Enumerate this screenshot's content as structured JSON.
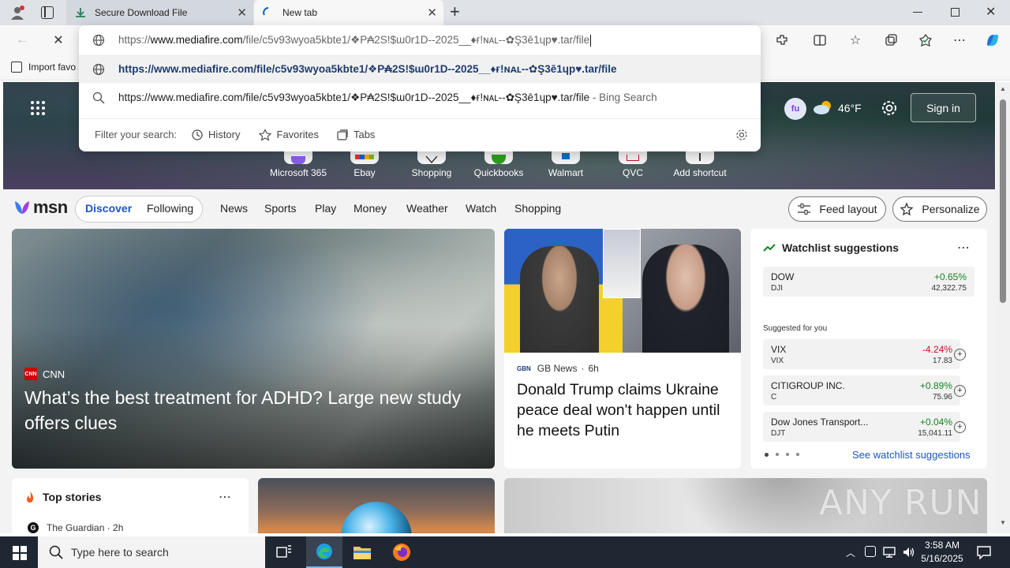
{
  "browser": {
    "tabs": [
      {
        "title": "Secure Download File",
        "active": false
      },
      {
        "title": "New tab",
        "active": true
      }
    ],
    "address_text": "https://www.mediafire.com/file/c5v93wyoa5kbte1/❖P₳2S!$ɯ0r1D--2025__♦ғ!ɴᴀʟ--✿Ş3ē1ɥp♥.tar/file",
    "address_host": "www.mediafire.com",
    "address_prefix": "https://",
    "address_path": "/file/c5v93wyoa5kbte1/❖P₳2S!$ɯ0r1D--2025__♦ғ!ɴᴀʟ--✿Ş3ē1ɥp♥.tar/file",
    "suggestion_url": "https://www.mediafire.com/file/c5v93wyoa5kbte1/❖P₳2S!$ɯ0r1D--2025__♦ғ!ɴᴀʟ--✿Ş3ē1ɥp♥.tar/file",
    "search_suggestion": "https://www.mediafire.com/file/c5v93wyoa5kbte1/❖P₳2S!$ɯ0r1D--2025__♦ғ!ɴᴀʟ--✿Ş3ē1ɥp♥.tar/file",
    "search_suffix": " - Bing Search",
    "filter_label": "Filter your search:",
    "filters": [
      "History",
      "Favorites",
      "Tabs"
    ],
    "favbar_import": "Import favo"
  },
  "hero": {
    "weather_temp": "46°F",
    "sign_in": "Sign in",
    "shortcuts": [
      "Microsoft 365",
      "Ebay",
      "Shopping",
      "Quickbooks",
      "Walmart",
      "QVC",
      "Add shortcut"
    ]
  },
  "msn": {
    "logo": "msn",
    "tabs": [
      "Discover",
      "Following"
    ],
    "nav": [
      "News",
      "Sports",
      "Play",
      "Money",
      "Weather",
      "Watch",
      "Shopping"
    ],
    "feed_layout": "Feed layout",
    "personalize": "Personalize"
  },
  "stories": {
    "main": {
      "source": "CNN",
      "headline": "What’s the best treatment for ADHD? Large new study offers clues"
    },
    "second": {
      "source": "GB News",
      "age": "6h",
      "headline": "Donald Trump claims Ukraine peace deal won't happen until he meets Putin"
    },
    "top_stories_title": "Top stories",
    "top_story_source": "The Guardian · 2h"
  },
  "watchlist": {
    "title": "Watchlist suggestions",
    "suggested_label": "Suggested for you",
    "see_more": "See watchlist suggestions",
    "main": {
      "name": "DOW",
      "ticker": "DJI",
      "change": "+0.65%",
      "price": "42,322.75",
      "direction": "up"
    },
    "items": [
      {
        "name": "VIX",
        "ticker": "VIX",
        "change": "-4.24%",
        "price": "17.83",
        "direction": "down"
      },
      {
        "name": "CITIGROUP INC.",
        "ticker": "C",
        "change": "+0.89%",
        "price": "75.96",
        "direction": "up"
      },
      {
        "name": "Dow Jones Transport...",
        "ticker": "DJT",
        "change": "+0.04%",
        "price": "15,041.11",
        "direction": "up"
      }
    ]
  },
  "taskbar": {
    "search_placeholder": "Type here to search",
    "time": "3:58 AM",
    "date": "5/16/2025"
  },
  "watermark": "ANY RUN"
}
